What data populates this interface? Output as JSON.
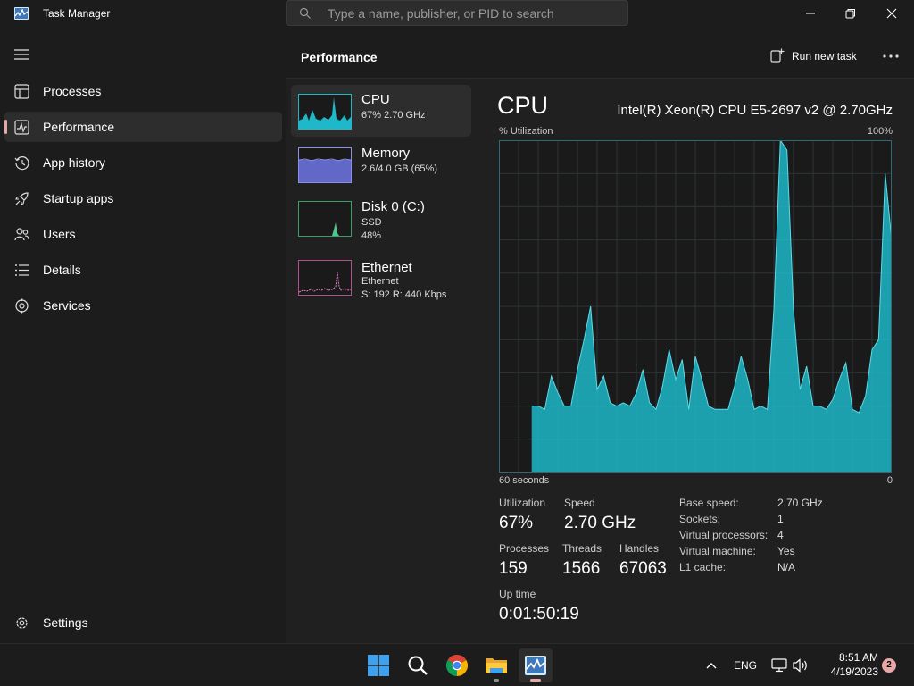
{
  "window": {
    "title": "Task Manager",
    "search_placeholder": "Type a name, publisher, or PID to search",
    "controls": [
      "minimize",
      "restore",
      "close"
    ]
  },
  "sidebar": {
    "items": [
      {
        "label": "Processes",
        "icon": "processes-icon",
        "active": false
      },
      {
        "label": "Performance",
        "icon": "performance-icon",
        "active": true
      },
      {
        "label": "App history",
        "icon": "history-icon",
        "active": false
      },
      {
        "label": "Startup apps",
        "icon": "startup-icon",
        "active": false
      },
      {
        "label": "Users",
        "icon": "users-icon",
        "active": false
      },
      {
        "label": "Details",
        "icon": "details-icon",
        "active": false
      },
      {
        "label": "Services",
        "icon": "services-icon",
        "active": false
      }
    ],
    "settings_label": "Settings"
  },
  "header": {
    "title": "Performance",
    "run_task_label": "Run new task"
  },
  "devices": [
    {
      "name": "CPU",
      "lines": [
        "67%  2.70 GHz"
      ],
      "color": "#1fb8c9",
      "active": true
    },
    {
      "name": "Memory",
      "lines": [
        "2.6/4.0 GB (65%)"
      ],
      "color": "#8b8fe8",
      "active": false
    },
    {
      "name": "Disk 0 (C:)",
      "lines": [
        "SSD",
        "48%"
      ],
      "color": "#4fc78a",
      "active": false
    },
    {
      "name": "Ethernet",
      "lines": [
        "Ethernet",
        "S: 192  R: 440 Kbps"
      ],
      "color": "#e07ac0",
      "active": false
    }
  ],
  "detail": {
    "title": "CPU",
    "model": "Intel(R) Xeon(R) CPU E5-2697 v2 @ 2.70GHz",
    "util_label": "% Utilization",
    "util_max": "100%",
    "x_left": "60 seconds",
    "x_right": "0",
    "stats": {
      "utilization_label": "Utilization",
      "utilization": "67%",
      "speed_label": "Speed",
      "speed": "2.70 GHz",
      "processes_label": "Processes",
      "processes": "159",
      "threads_label": "Threads",
      "threads": "1566",
      "handles_label": "Handles",
      "handles": "67063",
      "uptime_label": "Up time",
      "uptime": "0:01:50:19"
    },
    "specs": [
      {
        "key": "Base speed:",
        "value": "2.70 GHz"
      },
      {
        "key": "Sockets:",
        "value": "1"
      },
      {
        "key": "Virtual processors:",
        "value": "4"
      },
      {
        "key": "Virtual machine:",
        "value": "Yes"
      },
      {
        "key": "L1 cache:",
        "value": "N/A"
      }
    ]
  },
  "chart_data": {
    "type": "area",
    "color": "#1fb8c9",
    "xlim": [
      60,
      0
    ],
    "ylim": [
      0,
      100
    ],
    "grid": true,
    "x": [
      60,
      59,
      58,
      57,
      56,
      55,
      54,
      53,
      52,
      51,
      50,
      49,
      48,
      47,
      46,
      45,
      44,
      43,
      42,
      41,
      40,
      39,
      38,
      37,
      36,
      35,
      34,
      33,
      32,
      31,
      30,
      29,
      28,
      27,
      26,
      25,
      24,
      23,
      22,
      21,
      20,
      19,
      18,
      17,
      16,
      15,
      14,
      13,
      12,
      11,
      10,
      9,
      8,
      7,
      6,
      5,
      4,
      3,
      2,
      1,
      0
    ],
    "values": [
      20,
      20,
      19,
      29,
      24,
      20,
      20,
      31,
      40,
      50,
      25,
      29,
      21,
      20,
      21,
      20,
      24,
      31,
      21,
      19,
      26,
      37,
      28,
      34,
      19,
      35,
      28,
      20,
      19,
      19,
      19,
      26,
      35,
      28,
      19,
      20,
      19,
      49,
      100,
      97,
      49,
      25,
      32,
      20,
      20,
      19,
      22,
      28,
      33,
      19,
      18,
      23,
      37,
      40,
      90,
      70
    ],
    "title": "CPU",
    "ylabel": "% Utilization",
    "xlabel": "60 seconds"
  },
  "taskbar": {
    "apps": [
      {
        "name": "start-button",
        "icon": "windows-logo-icon"
      },
      {
        "name": "search-button",
        "icon": "search-icon"
      },
      {
        "name": "chrome-app",
        "icon": "chrome-icon"
      },
      {
        "name": "file-explorer-app",
        "icon": "folder-icon"
      },
      {
        "name": "task-manager-app",
        "icon": "task-manager-icon"
      }
    ],
    "language": "ENG",
    "time": "8:51 AM",
    "date": "4/19/2023",
    "notification_count": "2"
  }
}
